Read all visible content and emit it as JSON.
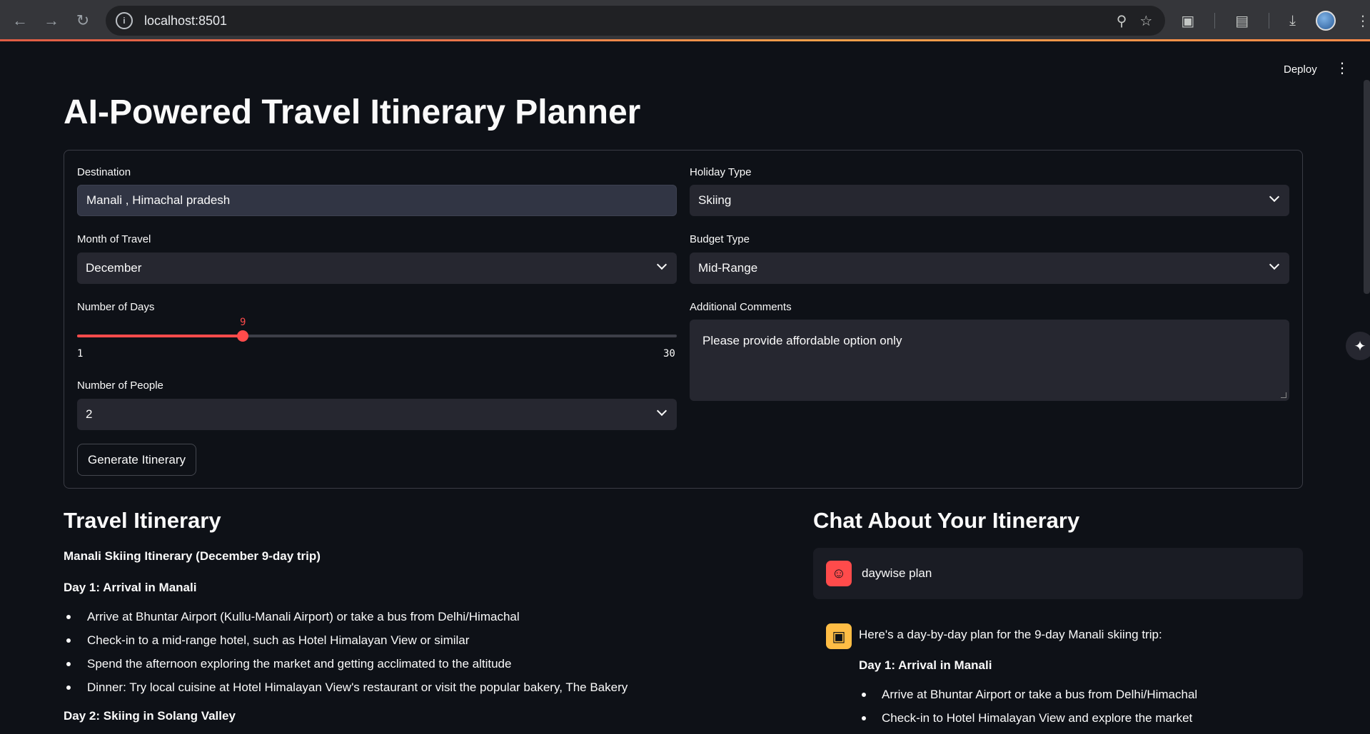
{
  "browser": {
    "url": "localhost:8501",
    "site_info_icon": "info-icon"
  },
  "header": {
    "deploy_label": "Deploy",
    "menu_icon": "kebab-icon"
  },
  "page": {
    "title": "AI-Powered Travel Itinerary Planner"
  },
  "form": {
    "destination": {
      "label": "Destination",
      "value": "Manali , Himachal pradesh"
    },
    "holiday_type": {
      "label": "Holiday Type",
      "value": "Skiing"
    },
    "month": {
      "label": "Month of Travel",
      "value": "December"
    },
    "budget": {
      "label": "Budget Type",
      "value": "Mid-Range"
    },
    "days": {
      "label": "Number of Days",
      "value": "9",
      "min": "1",
      "max": "30",
      "fraction": 0.2759
    },
    "comments": {
      "label": "Additional Comments",
      "value": "Please provide affordable option only"
    },
    "people": {
      "label": "Number of People",
      "value": "2"
    },
    "generate_label": "Generate Itinerary"
  },
  "itinerary": {
    "heading": "Travel Itinerary",
    "subtitle": "Manali Skiing Itinerary (December 9-day trip)",
    "day1_title": "Day 1: Arrival in Manali",
    "day1_items": [
      "Arrive at Bhuntar Airport (Kullu-Manali Airport) or take a bus from Delhi/Himachal",
      "Check-in to a mid-range hotel, such as Hotel Himalayan View or similar",
      "Spend the afternoon exploring the market and getting acclimated to the altitude",
      "Dinner: Try local cuisine at Hotel Himalayan View's restaurant or visit the popular bakery, The Bakery"
    ],
    "day2_title": "Day 2: Skiing in Solang Valley"
  },
  "chat": {
    "heading": "Chat About Your Itinerary",
    "user_message": "daywise plan",
    "bot_intro": "Here's a day-by-day plan for the 9-day Manali skiing trip:",
    "bot_day1_title": "Day 1: Arrival in Manali",
    "bot_day1_items": [
      "Arrive at Bhuntar Airport or take a bus from Delhi/Himachal",
      "Check-in to Hotel Himalayan View and explore the market"
    ]
  }
}
